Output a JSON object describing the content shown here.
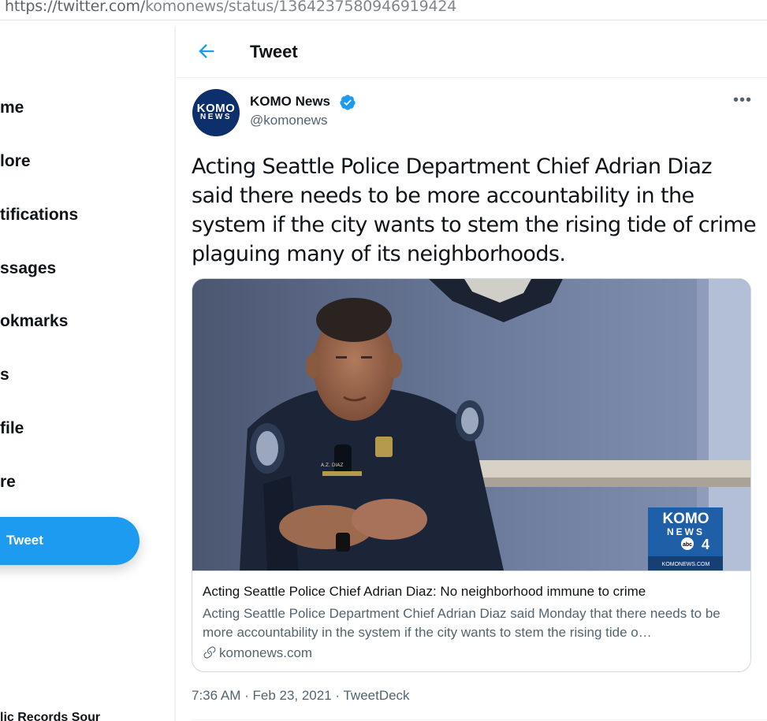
{
  "browser": {
    "url_host": "https://twitter.com/",
    "url_path": "komonews/status/1364237580946919424"
  },
  "sidebar": {
    "items": [
      {
        "label": "me"
      },
      {
        "label": "lore"
      },
      {
        "label": "tifications"
      },
      {
        "label": "ssages"
      },
      {
        "label": "okmarks"
      },
      {
        "label": "s"
      },
      {
        "label": "file"
      },
      {
        "label": "re"
      }
    ],
    "tweet_button": "Tweet",
    "trend_partial": "lic Records Sour"
  },
  "header": {
    "back_icon": "arrow-left-icon",
    "title": "Tweet"
  },
  "tweet": {
    "avatar_line1": "KOMO",
    "avatar_line2": "NEWS",
    "author_name": "KOMO News",
    "author_handle": "@komonews",
    "verified_icon": "verified-badge-icon",
    "more_icon": "more-options-icon",
    "text": "Acting Seattle Police Department Chief Adrian Diaz said there needs to be more accountability in the system if the city wants to stem the rising tide of crime plaguing many of its neighborhoods.",
    "card": {
      "image_logo_line1": "KOMO",
      "image_logo_line2": "NEWS",
      "image_logo_channel": "4",
      "image_logo_abc": "abc",
      "image_logo_site": "KOMONEWS.COM",
      "uniform_nametag": "A.Z. DIAZ",
      "title": "Acting Seattle Police Chief Adrian Diaz: No neighborhood immune to crime",
      "description": "Acting Seattle Police Department Chief Adrian Diaz said Monday that there needs to be more accountability in the system if the city wants to stem the rising tide o…",
      "link_icon": "link-icon",
      "domain": "komonews.com"
    },
    "timestamp": "7:36 AM · Feb 23, 2021 · TweetDeck"
  },
  "colors": {
    "accent": "#1d9bf0",
    "text_primary": "#0f1419",
    "text_secondary": "#536471",
    "border": "#cfd9de"
  }
}
